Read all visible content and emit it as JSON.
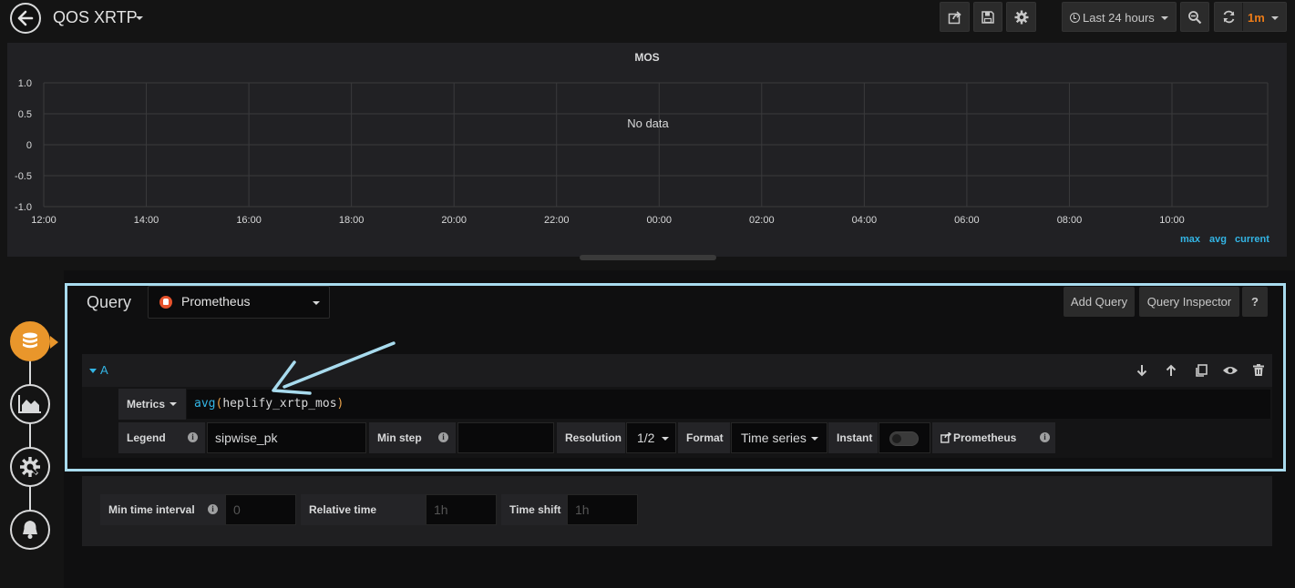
{
  "header": {
    "title": "QOS XRTP",
    "time_range": "Last 24 hours",
    "refresh_interval": "1m"
  },
  "panel": {
    "title": "MOS",
    "no_data_text": "No data",
    "legend": [
      "max",
      "avg",
      "current"
    ]
  },
  "chart_data": {
    "type": "line",
    "title": "MOS",
    "x_ticks": [
      "12:00",
      "14:00",
      "16:00",
      "18:00",
      "20:00",
      "22:00",
      "00:00",
      "02:00",
      "04:00",
      "06:00",
      "08:00",
      "10:00"
    ],
    "y_ticks": [
      "1.0",
      "0.5",
      "0",
      "-0.5",
      "-1.0"
    ],
    "ylim": [
      -1.0,
      1.0
    ],
    "series": [],
    "grid": true
  },
  "query": {
    "header": "Query",
    "datasource": "Prometheus",
    "add_query": "Add Query",
    "query_inspector": "Query Inspector",
    "help": "?",
    "ref_id": "A",
    "metrics_label": "Metrics",
    "metrics_value": "avg(heplify_xrtp_mos)",
    "legend_label": "Legend",
    "legend_value": "sipwise_pk",
    "min_step_label": "Min step",
    "min_step_value": "",
    "resolution_label": "Resolution",
    "resolution_value": "1/2",
    "format_label": "Format",
    "format_value": "Time series",
    "instant_label": "Instant",
    "instant_on": false,
    "prom_link_label": "Prometheus"
  },
  "options": {
    "min_interval_label": "Min time interval",
    "min_interval_placeholder": "0",
    "relative_time_label": "Relative time",
    "relative_time_placeholder": "1h",
    "time_shift_label": "Time shift",
    "time_shift_placeholder": "1h"
  },
  "colors": {
    "accent": "#33b5e5",
    "orange": "#e9962b",
    "highlight": "#a8dbee"
  }
}
